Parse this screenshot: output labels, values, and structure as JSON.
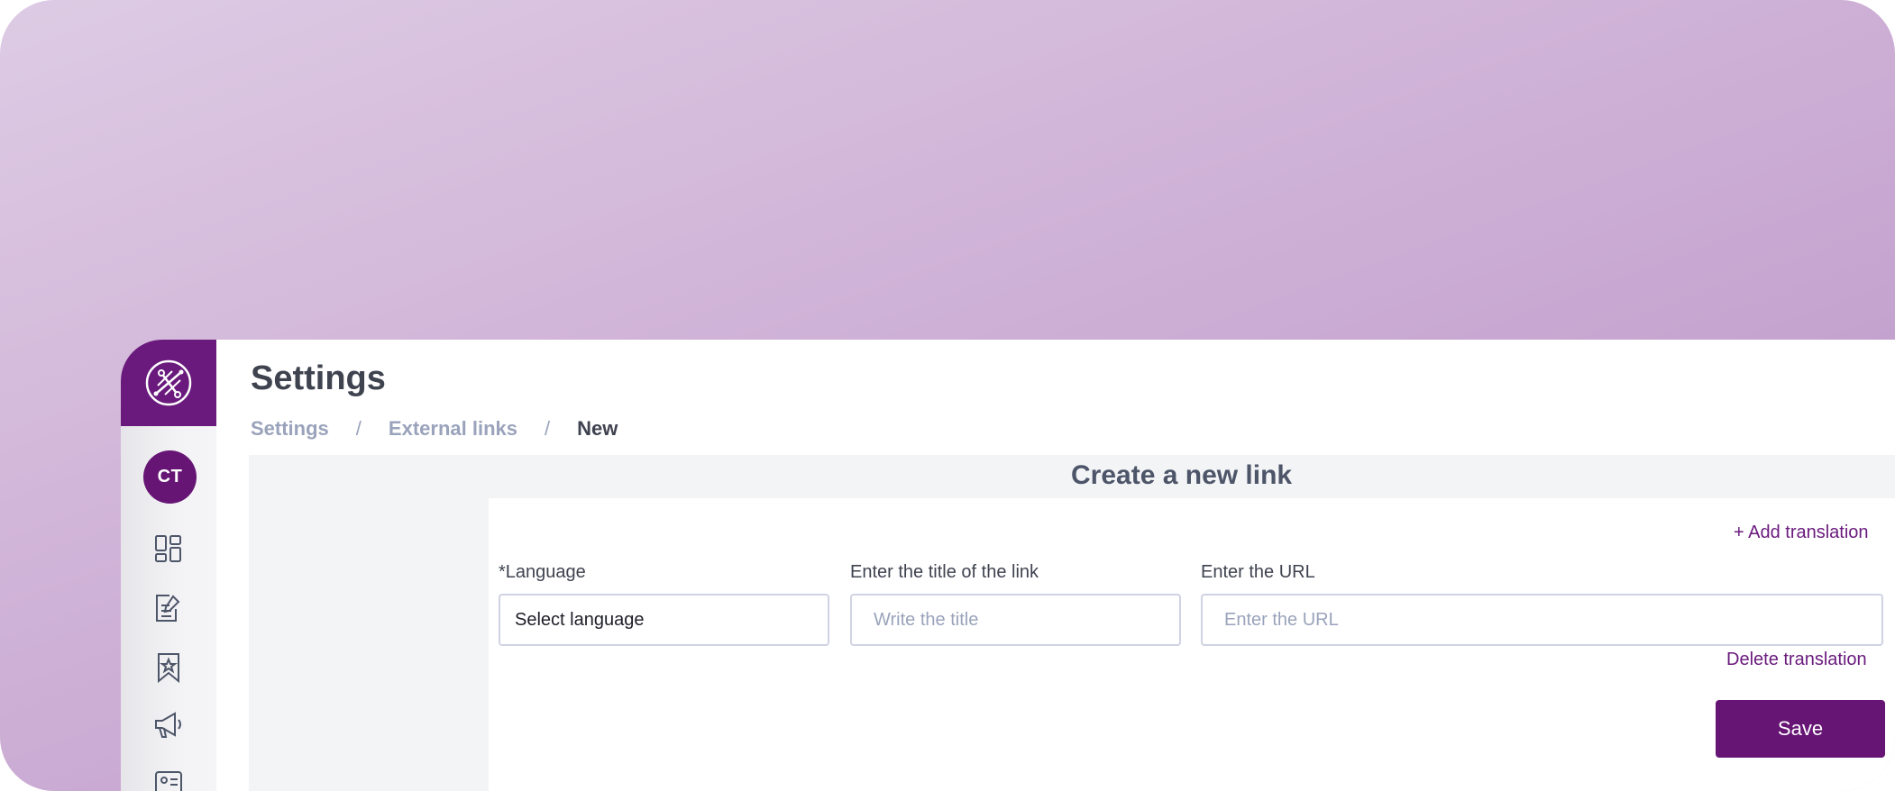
{
  "sidebar": {
    "logo_icon": "network-logo-icon",
    "avatar_initials": "CT",
    "icons": [
      "dashboard-icon",
      "edit-note-icon",
      "bookmark-star-icon",
      "megaphone-icon",
      "contact-card-icon"
    ]
  },
  "header": {
    "title": "Settings",
    "breadcrumb": [
      {
        "label": "Settings",
        "current": false
      },
      {
        "label": "External links",
        "current": false
      },
      {
        "label": "New",
        "current": true
      }
    ],
    "separator": "/"
  },
  "form": {
    "heading": "Create a new link",
    "add_translation": "+ Add translation",
    "delete_translation": "Delete translation",
    "language": {
      "label": "*Language",
      "value": "Select language"
    },
    "title": {
      "label": "Enter the title of the link",
      "placeholder": "Write the title",
      "value": ""
    },
    "url": {
      "label": "Enter the URL",
      "placeholder": "Enter the URL",
      "value": ""
    },
    "save_label": "Save"
  },
  "colors": {
    "brand": "#661574",
    "text_dark": "#3f4350",
    "text_muted": "#9aa3bb",
    "border": "#cfd3e3",
    "background_gradient": [
      "#ddcbe4",
      "#b98fc4"
    ]
  }
}
